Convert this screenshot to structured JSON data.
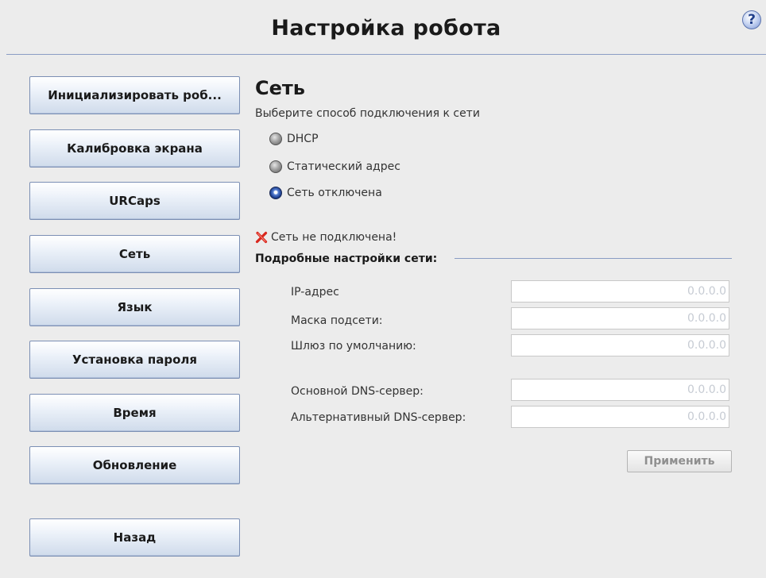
{
  "header": {
    "title": "Настройка робота",
    "help_glyph": "?"
  },
  "sidebar": {
    "items": [
      {
        "label": "Инициализировать роб..."
      },
      {
        "label": "Калибровка экрана"
      },
      {
        "label": "URCaps"
      },
      {
        "label": "Сеть"
      },
      {
        "label": "Язык"
      },
      {
        "label": "Установка пароля"
      },
      {
        "label": "Время"
      },
      {
        "label": "Обновление"
      }
    ],
    "back_label": "Назад"
  },
  "network": {
    "title": "Сеть",
    "subtitle": "Выберите способ подключения к сети",
    "options": [
      {
        "label": "DHCP",
        "selected": false
      },
      {
        "label": "Статический адрес",
        "selected": false
      },
      {
        "label": "Сеть отключена",
        "selected": true
      }
    ],
    "status": "Сеть не подключена!",
    "status_icon": "red-x-icon",
    "advanced_title": "Подробные настройки сети:",
    "fields": [
      {
        "label": "IP-адрес",
        "value": "0.0.0.0"
      },
      {
        "label": "Маска подсети:",
        "value": "0.0.0.0"
      },
      {
        "label": "Шлюз по умолчанию:",
        "value": "0.0.0.0"
      },
      {
        "label": "Основной DNS-сервер:",
        "value": "0.0.0.0"
      },
      {
        "label": "Альтернативный DNS-сервер:",
        "value": "0.0.0.0"
      }
    ],
    "apply_label": "Применить"
  },
  "colors": {
    "accent_line": "#8a9cc4",
    "button_gradient_bottom": "#cfdbeb",
    "status_x": "#d9261c",
    "selected_radio": "#1d3f8f"
  }
}
